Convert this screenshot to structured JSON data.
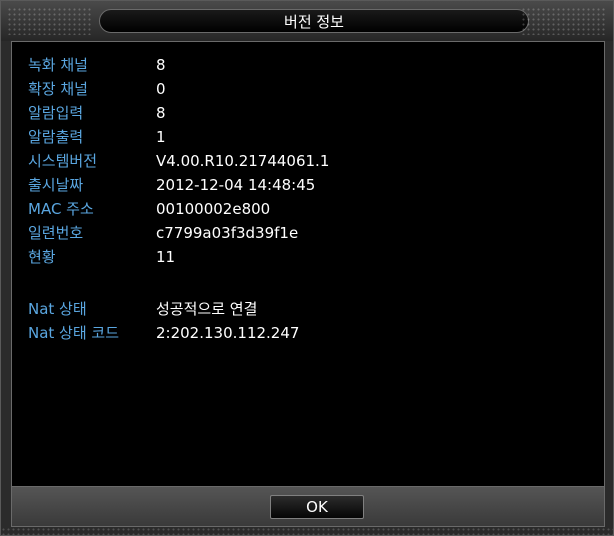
{
  "window": {
    "title": "버전 정보"
  },
  "info": [
    {
      "label": "녹화 채널",
      "value": "8"
    },
    {
      "label": "확장 채널",
      "value": "0"
    },
    {
      "label": "알람입력",
      "value": "8"
    },
    {
      "label": "알람출력",
      "value": "1"
    },
    {
      "label": "시스템버전",
      "value": "V4.00.R10.21744061.1"
    },
    {
      "label": "출시날짜",
      "value": "2012-12-04 14:48:45"
    },
    {
      "label": "MAC 주소",
      "value": "00100002e800"
    },
    {
      "label": "일련번호",
      "value": "c7799a03f3d39f1e"
    },
    {
      "label": "현황",
      "value": "11"
    }
  ],
  "nat": [
    {
      "label": "Nat 상태",
      "value": "성공적으로 연결"
    },
    {
      "label": "Nat 상태 코드",
      "value": "2:202.130.112.247"
    }
  ],
  "footer": {
    "ok_label": "OK"
  },
  "colors": {
    "label": "#5aa6e0",
    "value": "#ffffff",
    "background": "#000000"
  }
}
